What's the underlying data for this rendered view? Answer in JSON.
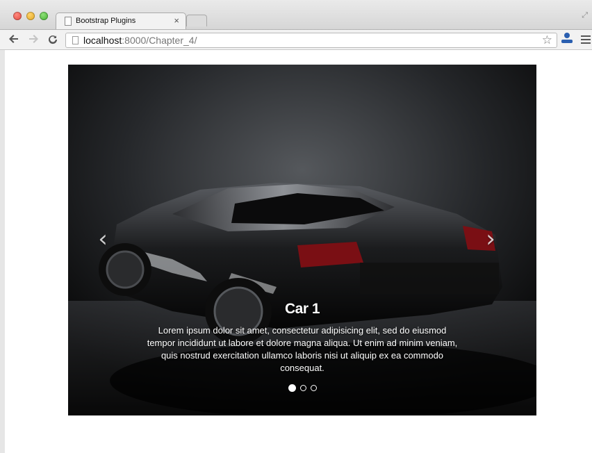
{
  "browser": {
    "tab_title": "Bootstrap Plugins",
    "tab_close": "×",
    "url_host": "localhost",
    "url_path": ":8000/Chapter_4/"
  },
  "icons": {
    "back": "arrow-left-icon",
    "forward": "arrow-right-icon",
    "reload": "reload-icon",
    "bookmark": "star-icon",
    "extension": "user-extension-icon",
    "menu": "hamburger-menu-icon"
  },
  "carousel": {
    "prev_glyph": "‹",
    "next_glyph": "›",
    "slide": {
      "title": "Car 1",
      "text": "Lorem ipsum dolor sit amet, consectetur adipisicing elit, sed do eiusmod tempor incididunt ut labore et dolore magna aliqua. Ut enim ad minim veniam, quis nostrud exercitation ullamco laboris nisi ut aliquip ex ea commodo consequat.",
      "image": "black-sports-car"
    },
    "indicator_count": 3,
    "active_index": 0
  }
}
